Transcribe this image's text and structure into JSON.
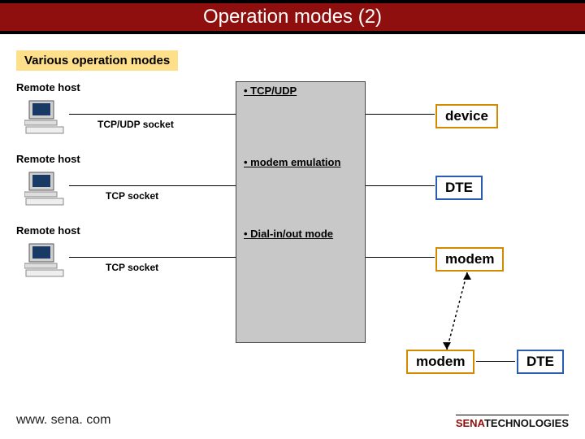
{
  "title": "Operation modes (2)",
  "subtitle": "Various operation modes",
  "rows": {
    "r1": {
      "host": "Remote host",
      "socket": "TCP/UDP socket",
      "mode": "• TCP/UDP",
      "right": "device"
    },
    "r2": {
      "host": "Remote host",
      "socket": "TCP socket",
      "mode": "• modem emulation",
      "right": "DTE"
    },
    "r3": {
      "host": "Remote host",
      "socket": "TCP socket",
      "mode": "• Dial-in/out mode",
      "right": "modem"
    }
  },
  "bottom": {
    "modem": "modem",
    "dte": "DTE"
  },
  "footer": {
    "url": "www. sena. com",
    "logo_a": "SENA",
    "logo_b": "TECHNOLOGIES"
  }
}
